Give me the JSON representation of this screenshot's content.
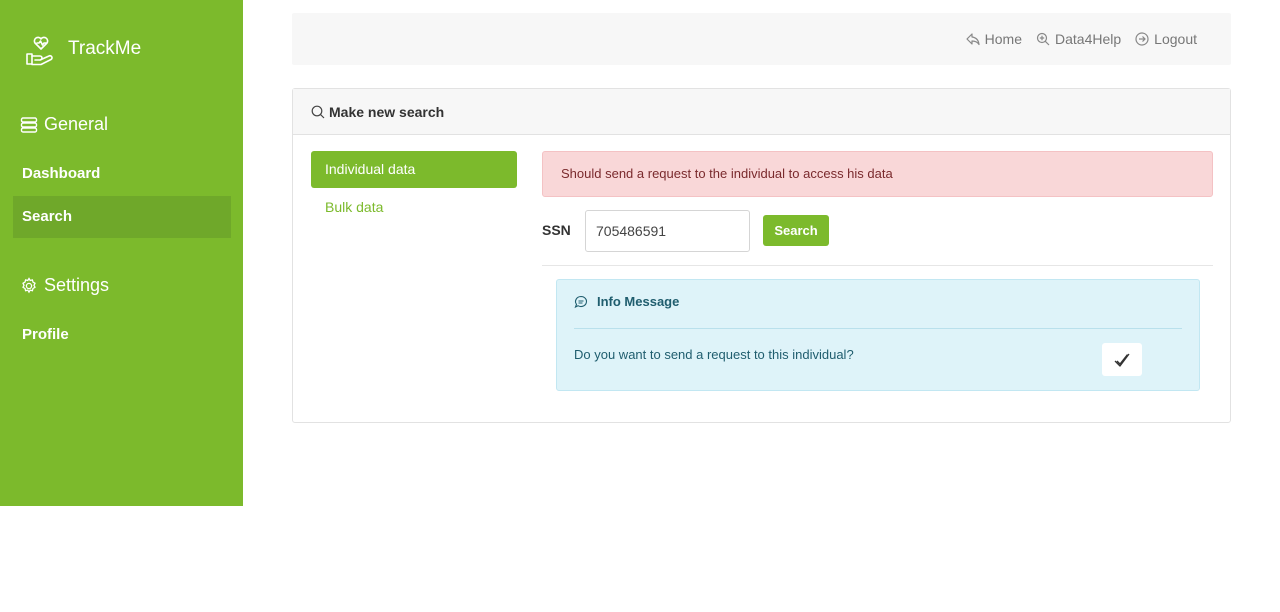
{
  "sidebar": {
    "brand": "TrackMe",
    "brand_icon": "heart-hand-icon",
    "sections": [
      {
        "label": "General",
        "icon": "server-stack-icon"
      },
      {
        "label": "Settings",
        "icon": "gear-icon"
      }
    ],
    "items": [
      {
        "label": "Dashboard",
        "active": false
      },
      {
        "label": "Search",
        "active": true
      },
      {
        "label": "Profile",
        "active": false
      }
    ]
  },
  "topnav": {
    "home": "Home",
    "data4help": "Data4Help",
    "logout": "Logout"
  },
  "card": {
    "title": "Make new search",
    "tabs": [
      {
        "label": "Individual data",
        "active": true
      },
      {
        "label": "Bulk data",
        "active": false
      }
    ],
    "alert": "Should send a request to the individual to access his data",
    "ssn_label": "SSN",
    "ssn_value": "705486591",
    "search_button": "Search",
    "info": {
      "title": "Info Message",
      "text": "Do you want to send a request to this individual?"
    }
  },
  "colors": {
    "brand_green": "#7cba2c",
    "alert_bg": "#f9d7d8",
    "info_bg": "#def3f9"
  }
}
